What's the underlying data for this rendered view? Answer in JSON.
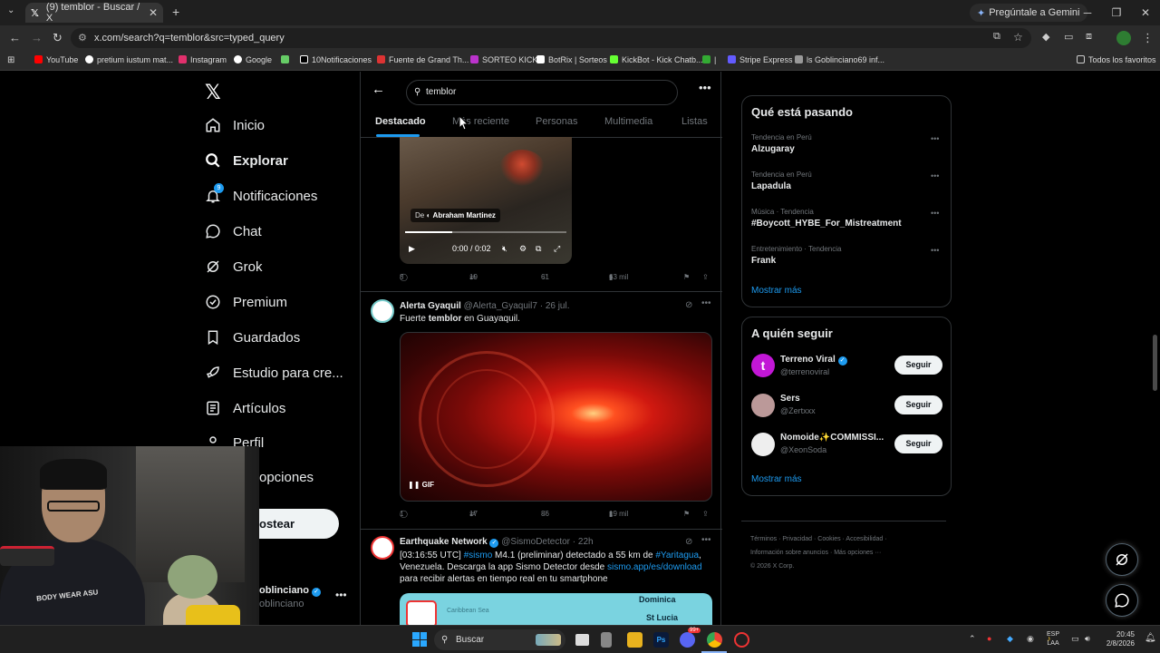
{
  "browser": {
    "tab_title": "(9) temblor - Buscar / X",
    "gemini_label": "Pregúntale a Gemini",
    "url": "x.com/search?q=temblor&src=typed_query",
    "bookmarks": [
      "YouTube",
      "pretium iustum mat...",
      "Instagram",
      "Google",
      "10Notificaciones",
      "Fuente de Grand Th...",
      "SORTEO KICK",
      "BotRix | Sorteos",
      "KickBot - Kick Chatb...",
      "Stripe Express",
      "ls Goblinciano69 inf..."
    ],
    "bookmarks_all": "Todos los favoritos"
  },
  "nav": {
    "items": [
      "Inicio",
      "Explorar",
      "Notificaciones",
      "Chat",
      "Grok",
      "Premium",
      "Guardados",
      "Estudio para cre...",
      "Artículos",
      "Perfil",
      "opciones"
    ],
    "notif_badge": "9",
    "post_button": "ostear",
    "profile_name": "oblinciano",
    "profile_handle": "oblinciano"
  },
  "search": {
    "query": "temblor",
    "tabs": [
      "Destacado",
      "Más reciente",
      "Personas",
      "Multimedia",
      "Listas"
    ]
  },
  "tweets": [
    {
      "video_from": "De",
      "video_author": "Abraham Martinez",
      "video_time": "0:00 / 0:02",
      "replies": "8",
      "retweets": "19",
      "likes": "61",
      "views": "63 mil"
    },
    {
      "name": "Alerta Gyaquil",
      "handle": "@Alerta_Gyaquil7",
      "date": "26 jul.",
      "text_pre": "Fuerte ",
      "text_bold": "temblor",
      "text_post": " en Guayaquil.",
      "gif_label": "GIF",
      "replies": "1",
      "retweets": "17",
      "likes": "86",
      "views": "19 mil"
    },
    {
      "name": "Earthquake Network",
      "handle": "@SismoDetector",
      "date": "22h",
      "line1_a": "[03:16:55 UTC] ",
      "line1_tag": "#sismo",
      "line1_b": " M4.1 (preliminar) detectado a 55 km de ",
      "line1_tag2": "#Yaritagua",
      "line1_c": ",",
      "line2_a": "Venezuela. Descarga la app Sismo Detector desde ",
      "line2_link": "sismo.app/es/download",
      "line3": "para recibir alertas en tiempo real en tu smartphone",
      "map_sea": "Caribbean Sea",
      "map_city1": "Dominica",
      "map_city2": "St Lucia"
    }
  ],
  "trends": {
    "title": "Qué está pasando",
    "items": [
      {
        "meta": "Tendencia en Perú",
        "title": "Alzugaray"
      },
      {
        "meta": "Tendencia en Perú",
        "title": "Lapadula"
      },
      {
        "meta": "Música · Tendencia",
        "title": "#Boycott_HYBE_For_Mistreatment"
      },
      {
        "meta": "Entretenimiento · Tendencia",
        "title": "Frank"
      }
    ],
    "show_more": "Mostrar más"
  },
  "who_to_follow": {
    "title": "A quién seguir",
    "items": [
      {
        "name": "Terreno Viral",
        "handle": "@terrenoviral",
        "button": "Seguir"
      },
      {
        "name": "Sers",
        "handle": "@Zertxxx",
        "button": "Seguir"
      },
      {
        "name": "Ñomoide✨COMMISSI...",
        "handle": "@XeonSoda",
        "button": "Seguir"
      }
    ],
    "show_more": "Mostrar más"
  },
  "footer": {
    "line1": "Términos · Privacidad · Cookies · Accesibilidad ·",
    "line2": "Información sobre anuncios · Más opciones ···",
    "line3": "© 2026 X Corp."
  },
  "taskbar": {
    "search": "Buscar",
    "lang1": "ESP",
    "lang2": "LAA",
    "time": "20:45",
    "date": "2/8/2026",
    "discord_badge": "99+"
  },
  "webcam": {
    "shirt_text": "BODY WEAR ASU"
  },
  "colors": {
    "accent": "#1d9bf0",
    "background": "#000000",
    "border": "#2f3336",
    "muted": "#71767b"
  }
}
